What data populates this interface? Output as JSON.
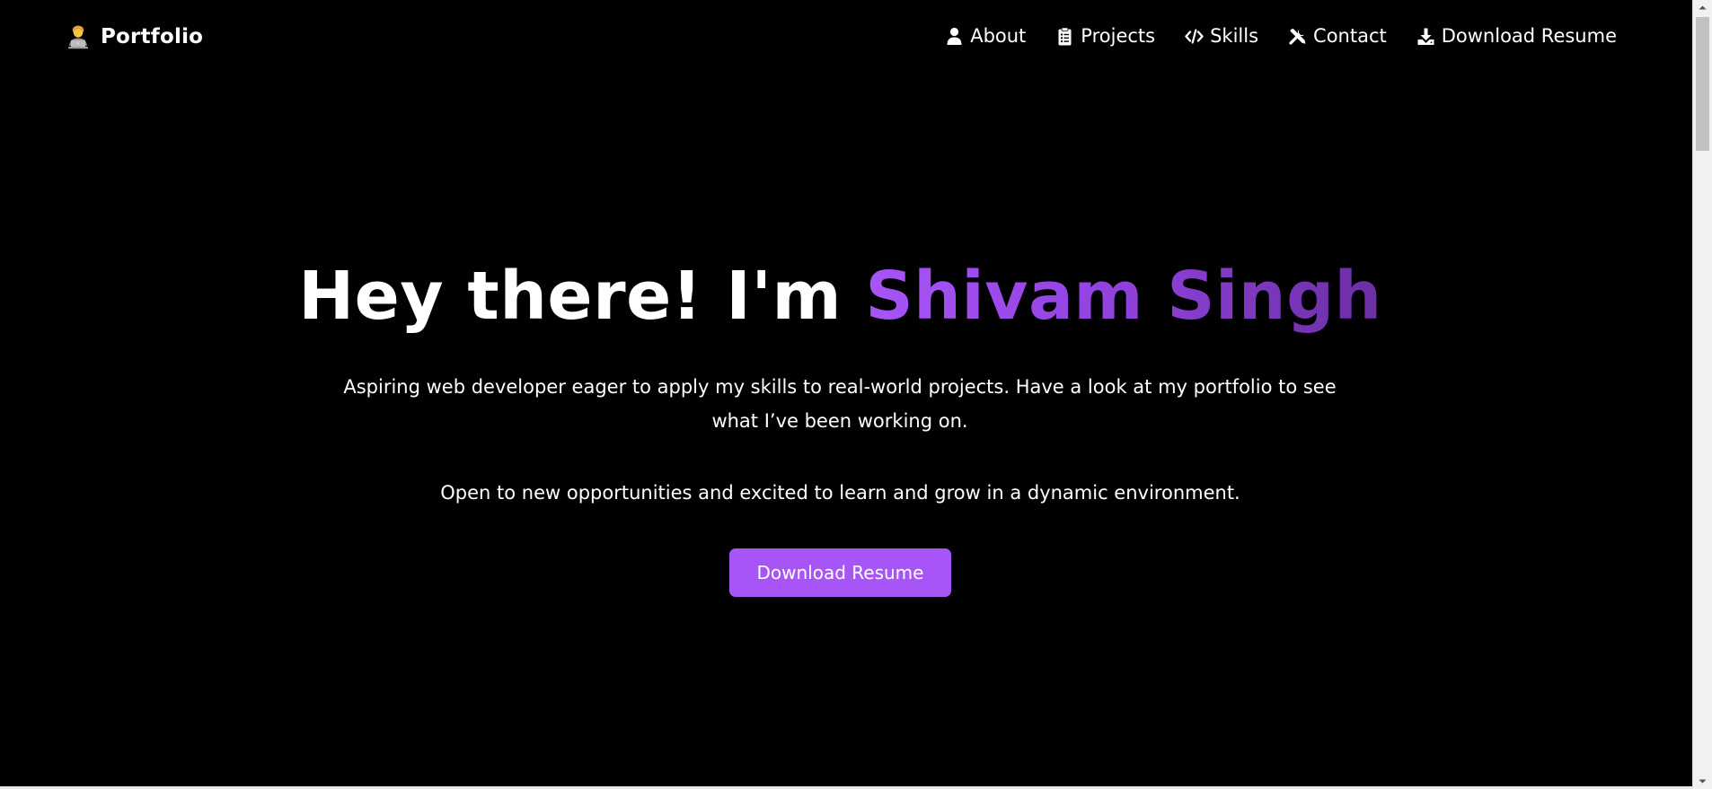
{
  "brand": {
    "icon": "technologist-emoji-icon",
    "title": "Portfolio"
  },
  "nav": {
    "items": [
      {
        "label": "About",
        "icon": "user-icon"
      },
      {
        "label": "Projects",
        "icon": "clipboard-icon"
      },
      {
        "label": "Skills",
        "icon": "code-icon"
      },
      {
        "label": "Contact",
        "icon": "tools-icon"
      },
      {
        "label": "Download Resume",
        "icon": "download-icon"
      }
    ]
  },
  "hero": {
    "greeting": "Hey there! I'm ",
    "name": "Shivam Singh",
    "description": "Aspiring web developer eager to apply my skills to real-world projects. Have a look at my portfolio to see what I’ve been working on.",
    "description2": "Open to new opportunities and excited to learn and grow in a dynamic environment.",
    "button_label": "Download Resume"
  },
  "colors": {
    "background": "#000000",
    "accent": "#a855f7",
    "accent_dark": "#6b2fa3",
    "text": "#ffffff"
  }
}
